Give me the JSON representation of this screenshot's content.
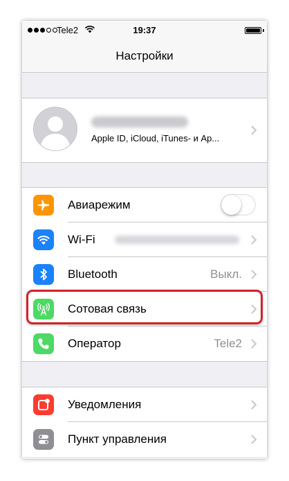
{
  "status_bar": {
    "carrier": "Tele2",
    "time": "19:37",
    "signal_bars": 3
  },
  "nav": {
    "title": "Настройки"
  },
  "profile": {
    "name": "",
    "subtitle": "Apple ID, iCloud, iTunes- и Ap..."
  },
  "group1": [
    {
      "label": "Авиарежим",
      "icon": "airplane-icon",
      "color": "#ff9500",
      "toggle": false
    },
    {
      "label": "Wi-Fi",
      "icon": "wifi-icon",
      "color": "#1a82fb",
      "value": ""
    },
    {
      "label": "Bluetooth",
      "icon": "bluetooth-icon",
      "color": "#1a82fb",
      "value": "Выкл."
    },
    {
      "label": "Сотовая связь",
      "icon": "cellular-icon",
      "color": "#4cd964",
      "value": "",
      "highlighted": true
    },
    {
      "label": "Оператор",
      "icon": "phone-icon",
      "color": "#4cd964",
      "value": "Tele2"
    }
  ],
  "group2": [
    {
      "label": "Уведомления",
      "icon": "notifications-icon",
      "color": "#ff3b30"
    },
    {
      "label": "Пункт управления",
      "icon": "control-center-icon",
      "color": "#8e8e93"
    }
  ],
  "colors": {
    "highlight": "#d3212c"
  }
}
